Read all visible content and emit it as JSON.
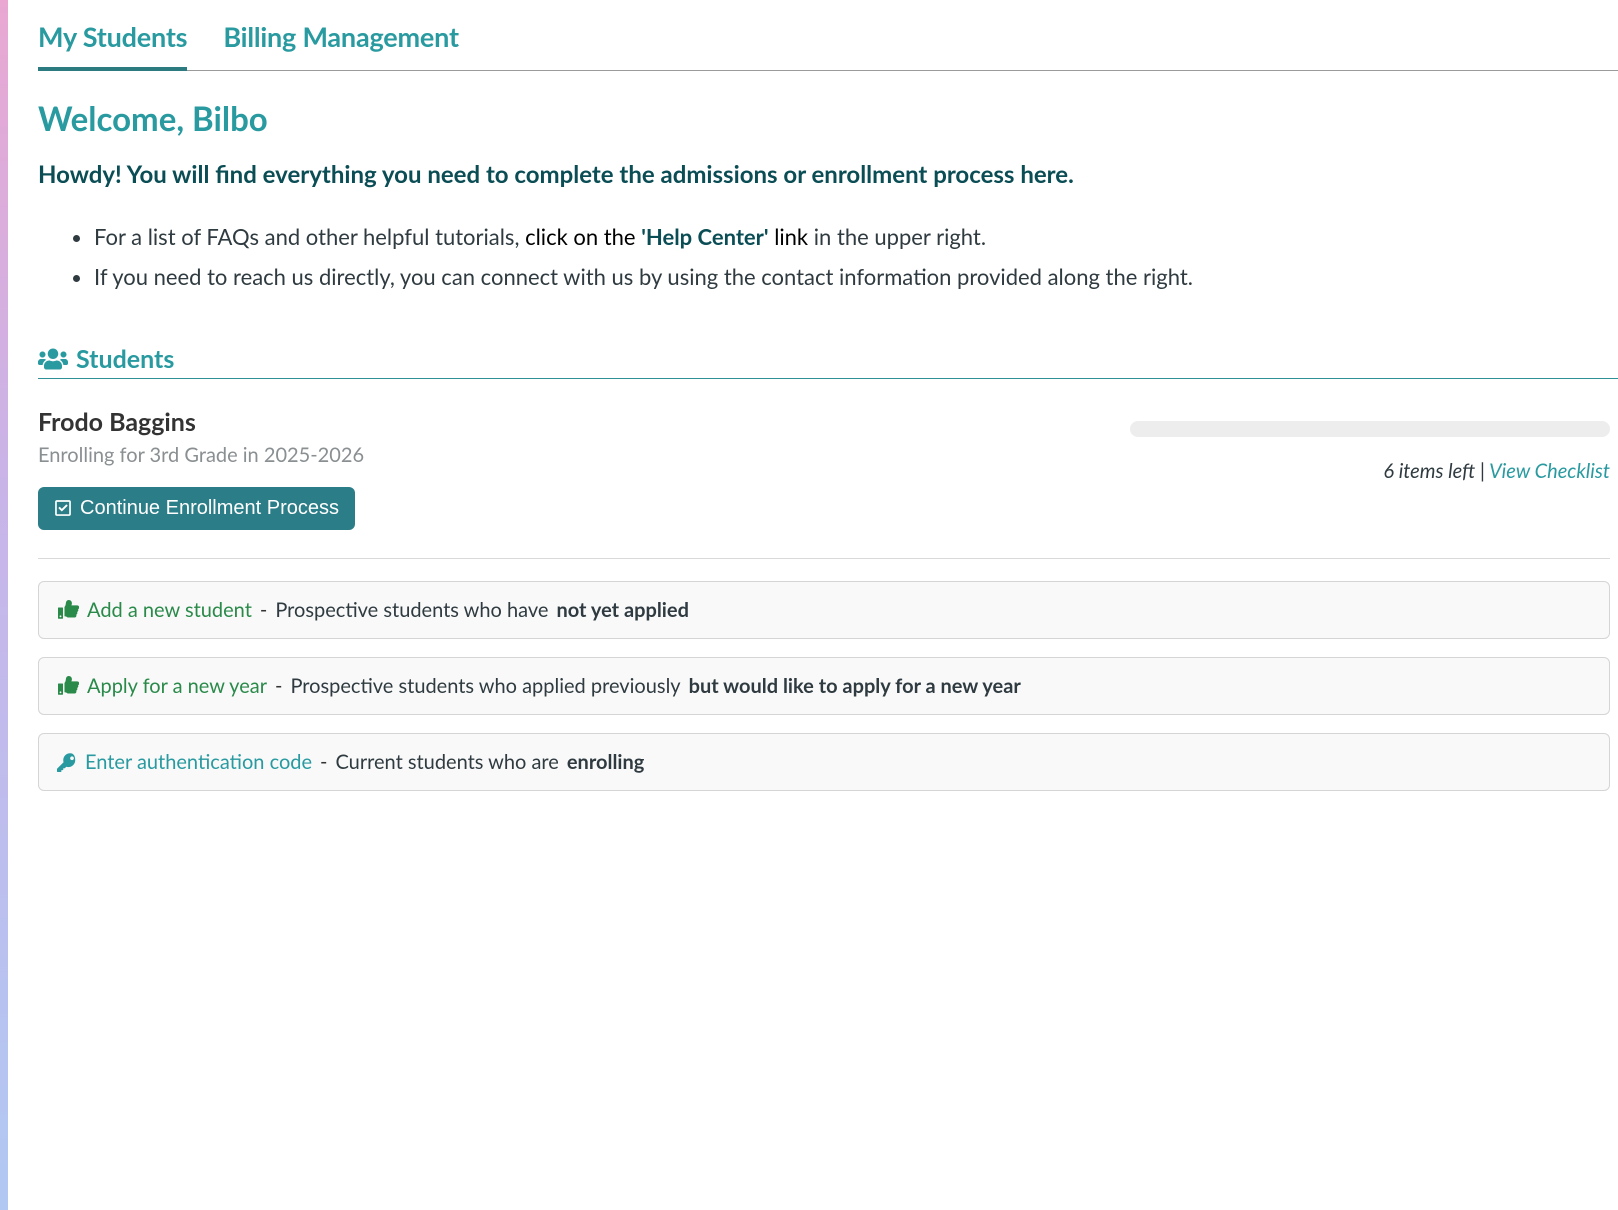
{
  "tabs": {
    "my_students": "My Students",
    "billing": "Billing Management"
  },
  "welcome": {
    "title": "Welcome, Bilbo",
    "subtitle": "Howdy! You will find everything you need to complete the admissions or enrollment process here.",
    "bullet1_prefix": "For a list of FAQs and other helpful tutorials, ",
    "bullet1_black1": "click on the",
    "bullet1_emph": "'Help Center'",
    "bullet1_black2": "link",
    "bullet1_suffix": " in the upper right.",
    "bullet2": "If you need to reach us directly, you can connect with us by using the contact information provided along the right."
  },
  "students_heading": "Students",
  "student": {
    "name": "Frodo Baggins",
    "enrolling": "Enrolling for 3rd Grade in 2025-2026",
    "button": "Continue Enrollment Process",
    "items_left": "6 items left",
    "view_checklist": "View Checklist"
  },
  "actions": {
    "add": {
      "link": "Add a new student",
      "desc_prefix": "Prospective students who have ",
      "desc_bold": "not yet applied"
    },
    "apply": {
      "link": "Apply for a new year",
      "desc_prefix": "Prospective students who applied previously ",
      "desc_bold": "but would like to apply for a new year"
    },
    "auth": {
      "link": "Enter authentication code",
      "desc_prefix": "Current students who are ",
      "desc_bold": "enrolling"
    }
  }
}
